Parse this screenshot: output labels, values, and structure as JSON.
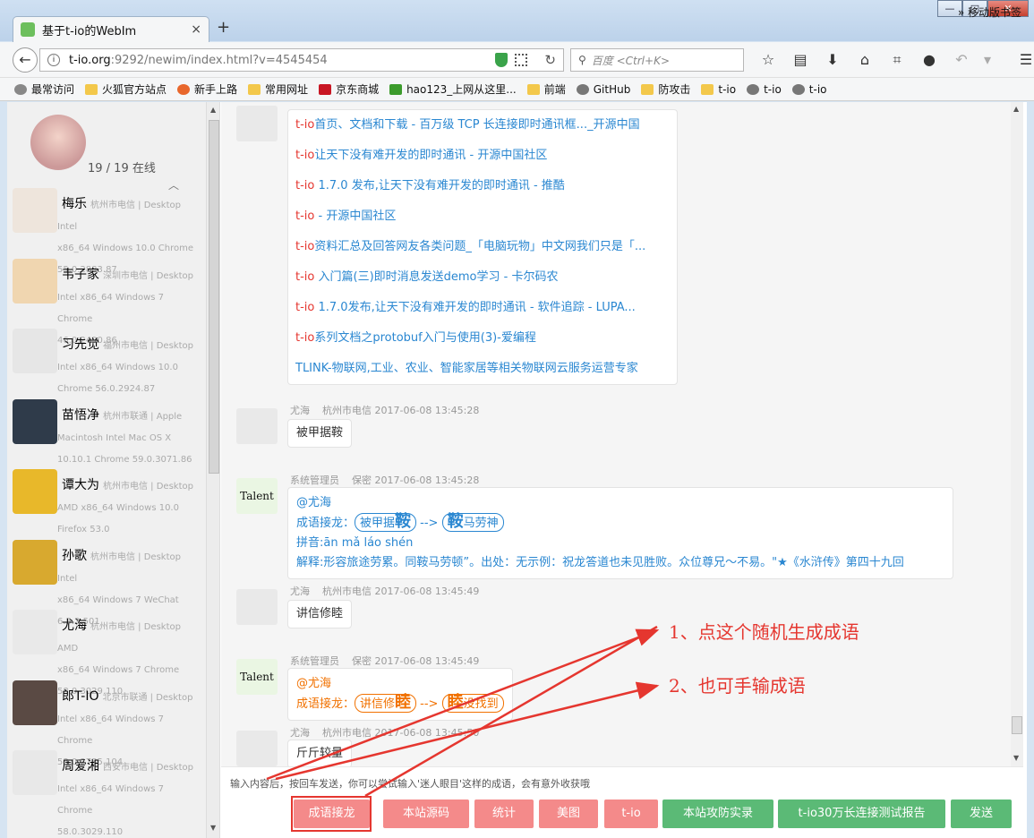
{
  "browser": {
    "tab_title": "基于t-io的WebIm",
    "url_host": "t-io.org",
    "url_path": ":9292/newim/index.html?v=4545454",
    "search_placeholder": "百度 <Ctrl+K>",
    "window_buttons": [
      "—",
      "□",
      "✕"
    ]
  },
  "bookmarks": [
    {
      "label": "最常访问",
      "icon": "gear"
    },
    {
      "label": "火狐官方站点",
      "icon": "folder"
    },
    {
      "label": "新手上路",
      "icon": "fire"
    },
    {
      "label": "常用网址",
      "icon": "folder"
    },
    {
      "label": "京东商城",
      "icon": "jd"
    },
    {
      "label": "hao123_上网从这里...",
      "icon": "hao"
    },
    {
      "label": "前端",
      "icon": "folder"
    },
    {
      "label": "GitHub",
      "icon": "globe"
    },
    {
      "label": "防攻击",
      "icon": "folder"
    },
    {
      "label": "t-io",
      "icon": "folder"
    },
    {
      "label": "t-io",
      "icon": "globe"
    },
    {
      "label": "t-io",
      "icon": "globe"
    }
  ],
  "bookmarks_right": "» 移动版书签",
  "sidebar": {
    "online": "19 / 19 在线",
    "users": [
      {
        "name": "梅乐",
        "l1": "杭州市电信 | Desktop Intel",
        "l2": "x86_64 Windows 10.0 Chrome",
        "l3": "55.0.2883.87",
        "color": "#eee5dc"
      },
      {
        "name": "韦子家",
        "l1": "深圳市电信 | Desktop",
        "l2": "Intel x86_64 Windows 7 Chrome",
        "l3": "46.0.2490.86",
        "color": "#f0d6b0"
      },
      {
        "name": "习先觉",
        "l1": "福州市电信 | Desktop",
        "l2": "Intel x86_64 Windows 10.0",
        "l3": "Chrome 56.0.2924.87",
        "color": "#e6e6e6"
      },
      {
        "name": "苗悟净",
        "l1": "杭州市联通 | Apple",
        "l2": "Macintosh Intel Mac OS X",
        "l3": "10.10.1 Chrome 59.0.3071.86",
        "color": "#2f3b4a"
      },
      {
        "name": "谭大为",
        "l1": "杭州市电信 | Desktop",
        "l2": "AMD x86_64 Windows 10.0",
        "l3": "Firefox 53.0",
        "color": "#e8b82a"
      },
      {
        "name": "孙歌",
        "l1": "杭州市电信 | Desktop Intel",
        "l2": "x86_64 Windows 7 WeChat",
        "l3": "6.5.2.501",
        "color": "#d8a92f"
      },
      {
        "name": "尤海",
        "l1": "杭州市电信 | Desktop AMD",
        "l2": "x86_64 Windows 7 Chrome",
        "l3": "58.0.3029.110",
        "color": "#e9e9e9"
      },
      {
        "name": "郎T-IO",
        "l1": "北京市联通 | Desktop",
        "l2": "Intel x86_64 Windows 7 Chrome",
        "l3": "53.0.2785.104",
        "color": "#5a4a44"
      },
      {
        "name": "周爱湘",
        "l1": "西安市电信 | Desktop",
        "l2": "Intel x86_64 Windows 7 Chrome",
        "l3": "58.0.3029.110",
        "color": "#e8e8e8"
      }
    ]
  },
  "chat": {
    "links": [
      "首页、文档和下载 - 百万级 TCP 长连接即时通讯框..._开源中国",
      "让天下没有难开发的即时通讯 - 开源中国社区",
      " 1.7.0 发布,让天下没有难开发的即时通讯 - 推酷",
      " - 开源中国社区",
      "资料汇总及回答网友各类问题_「电脑玩物」中文网我们只是「...",
      " 入门篇(三)即时消息发送demo学习 - 卡尔码农",
      " 1.7.0发布,让天下没有难开发的即时通讯 - 软件追踪 - LUPA...",
      "系列文档之protobuf入门与使用(3)-爱编程"
    ],
    "links_prefix": "t-io",
    "last_link": "TLINK-物联网,工业、农业、智能家居等相关物联网云服务运营专家",
    "m1": {
      "name": "尤海",
      "meta": "杭州市电信 2017-06-08 13:45:28",
      "text": "被甲据鞍"
    },
    "m2": {
      "name": "系统管理员",
      "meta": "保密 2017-06-08 13:45:28",
      "at": "@尤海",
      "label": "成语接龙：",
      "a_pre": "被甲据",
      "a_key": "鞍",
      "arrow": "-->",
      "b_key": "鞍",
      "b_post": "马劳神",
      "pinyin": "拼音:ān mǎ láo shén",
      "explain": "解释:形容旅途劳累。同鞍马劳顿”。出处：无示例：祝龙答道也未见胜败。众位尊兄～不易。\"★《水浒传》第四十九回"
    },
    "m3": {
      "name": "尤海",
      "meta": "杭州市电信 2017-06-08 13:45:49",
      "text": "讲信修睦"
    },
    "m4": {
      "name": "系统管理员",
      "meta": "保密 2017-06-08 13:45:49",
      "at": "@尤海",
      "label": "成语接龙：",
      "a_pre": "讲信修",
      "a_key": "睦",
      "arrow": "-->",
      "b_key": "睦",
      "b_post": "没找到"
    },
    "m5": {
      "name": "尤海",
      "meta": "杭州市电信 2017-06-08 13:45:50",
      "text": "斤斤较量"
    },
    "avatar_text": "Talent"
  },
  "annotations": [
    "1、点这个随机生成成语",
    "2、也可手输成语"
  ],
  "composer": {
    "hint": "输入内容后，按回车发送，你可以尝试输入'迷人眼目'这样的成语，会有意外收获哦",
    "buttons": [
      "成语接龙",
      "本站源码",
      "统计",
      "美图",
      "t-io",
      "本站攻防实录",
      "t-io30万长连接测试报告",
      "发送"
    ]
  },
  "colors": {
    "link": "#2a87d1",
    "red": "#e5362f",
    "pink_btn": "#f48a8a",
    "green_btn": "#5bba76"
  }
}
